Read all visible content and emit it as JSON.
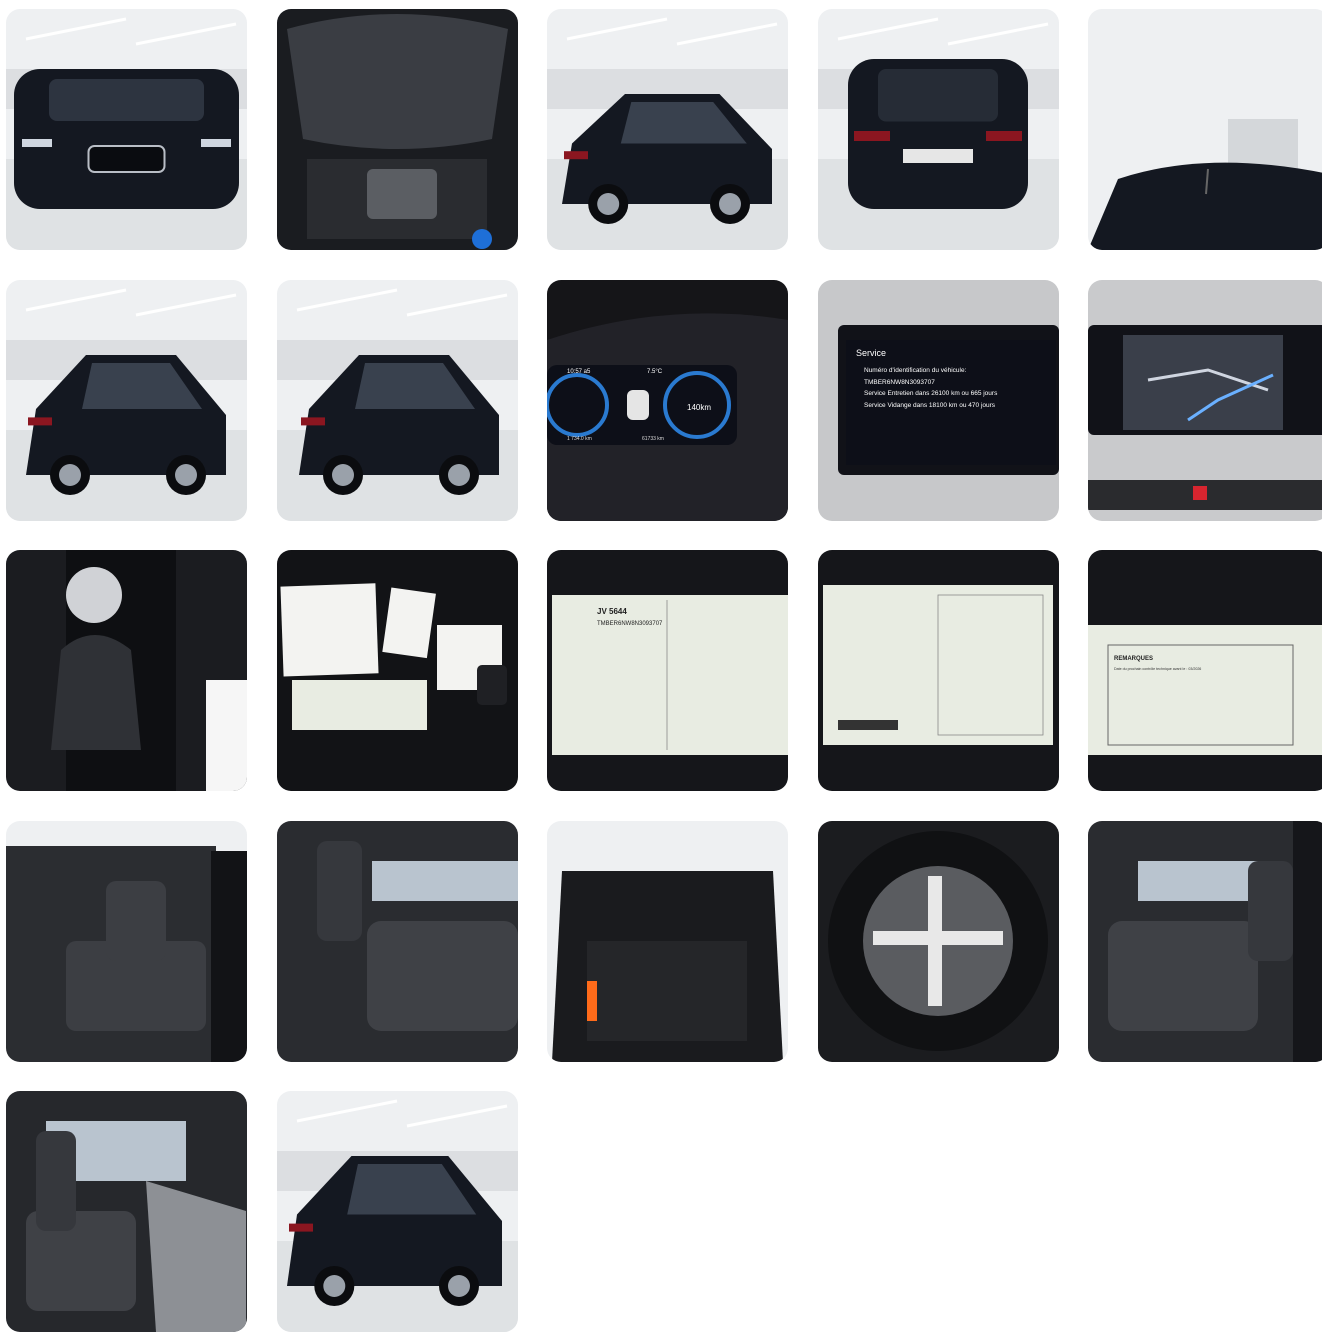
{
  "gallery": {
    "photos": [
      {
        "subject": "front-exterior",
        "icon": "car-front-icon"
      },
      {
        "subject": "engine-bay",
        "icon": "engine-icon"
      },
      {
        "subject": "rear-three-quarter-exterior",
        "icon": "car-side-icon"
      },
      {
        "subject": "rear-exterior",
        "icon": "car-rear-icon"
      },
      {
        "subject": "roof-exterior",
        "icon": "car-roof-icon"
      },
      {
        "subject": "rear-three-quarter-left-exterior",
        "icon": "car-side-icon"
      },
      {
        "subject": "front-three-quarter-exterior",
        "icon": "car-side-icon"
      },
      {
        "subject": "instrument-cluster",
        "icon": "gauge-icon",
        "texts": {
          "time": "10:57 a5",
          "temp": "7.5°C",
          "speed": "140km",
          "odometer": "1 734.0 km",
          "trip": "61733 km"
        }
      },
      {
        "subject": "infotainment-service-screen",
        "icon": "screen-icon",
        "texts": {
          "title": "Service",
          "line1": "Numéro d'identification du véhicule:",
          "vin": "TMBER6NW8N3093707",
          "line2": "Service Entretien dans 26100 km ou 665 jours",
          "line3": "Service Vidange dans 18100 km ou 470 jours"
        }
      },
      {
        "subject": "infotainment-navigation-screen",
        "icon": "map-icon"
      },
      {
        "subject": "gear-shifter",
        "icon": "gear-shift-icon"
      },
      {
        "subject": "documents",
        "icon": "document-icon"
      },
      {
        "subject": "registration-document",
        "icon": "document-icon",
        "texts": {
          "plate": "JV 5644",
          "vin": "TMBER6NW8N3093707"
        }
      },
      {
        "subject": "registration-document-back",
        "icon": "document-icon"
      },
      {
        "subject": "registration-remarks",
        "icon": "document-icon",
        "texts": {
          "heading": "REMARQUES",
          "note": "Date du prochain contrôle technique avant le : 03/2026"
        }
      },
      {
        "subject": "front-interior",
        "icon": "car-seat-icon"
      },
      {
        "subject": "rear-seats",
        "icon": "car-seat-icon"
      },
      {
        "subject": "trunk",
        "icon": "trunk-icon"
      },
      {
        "subject": "spare-wheel",
        "icon": "wheel-icon"
      },
      {
        "subject": "rear-seats-right",
        "icon": "car-seat-icon"
      },
      {
        "subject": "front-passenger-interior",
        "icon": "car-seat-icon"
      },
      {
        "subject": "front-three-quarter-exterior-2",
        "icon": "car-side-icon"
      }
    ]
  },
  "colors": {
    "page_background": "#ffffff",
    "car_body": "#141821",
    "showroom_wall": "#eef0f2",
    "showroom_floor": "#dfe2e4",
    "interior_fabric": "#2b2d31",
    "document_paper": "#e8ece2",
    "screen": "#0d0f18"
  }
}
